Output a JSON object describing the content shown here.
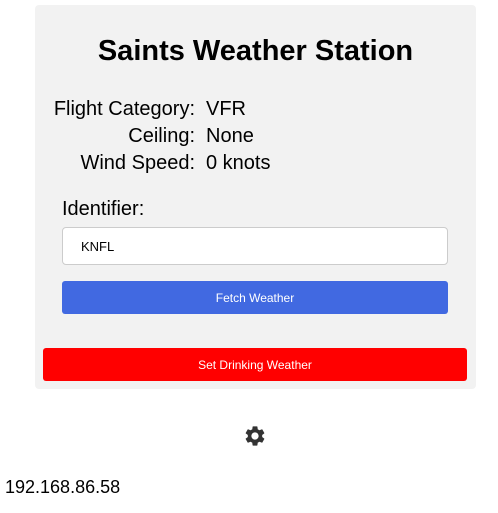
{
  "station": {
    "title": "Saints Weather Station"
  },
  "info": [
    {
      "label": "Flight Category:",
      "value": "VFR"
    },
    {
      "label": "Ceiling:",
      "value": "None"
    },
    {
      "label": "Wind Speed:",
      "value": "0 knots"
    }
  ],
  "identifier": {
    "label": "Identifier:",
    "value": "KNFL"
  },
  "buttons": {
    "fetch_label": "Fetch Weather",
    "drinking_label": "Set Drinking Weather"
  },
  "settings": {
    "icon": "gear-icon"
  },
  "footer": {
    "ip_address": "192.168.86.58"
  },
  "colors": {
    "card_bg": "#f2f2f2",
    "fetch_button": "#4169e1",
    "drinking_button": "#ff0000",
    "gear_icon": "#333333"
  }
}
